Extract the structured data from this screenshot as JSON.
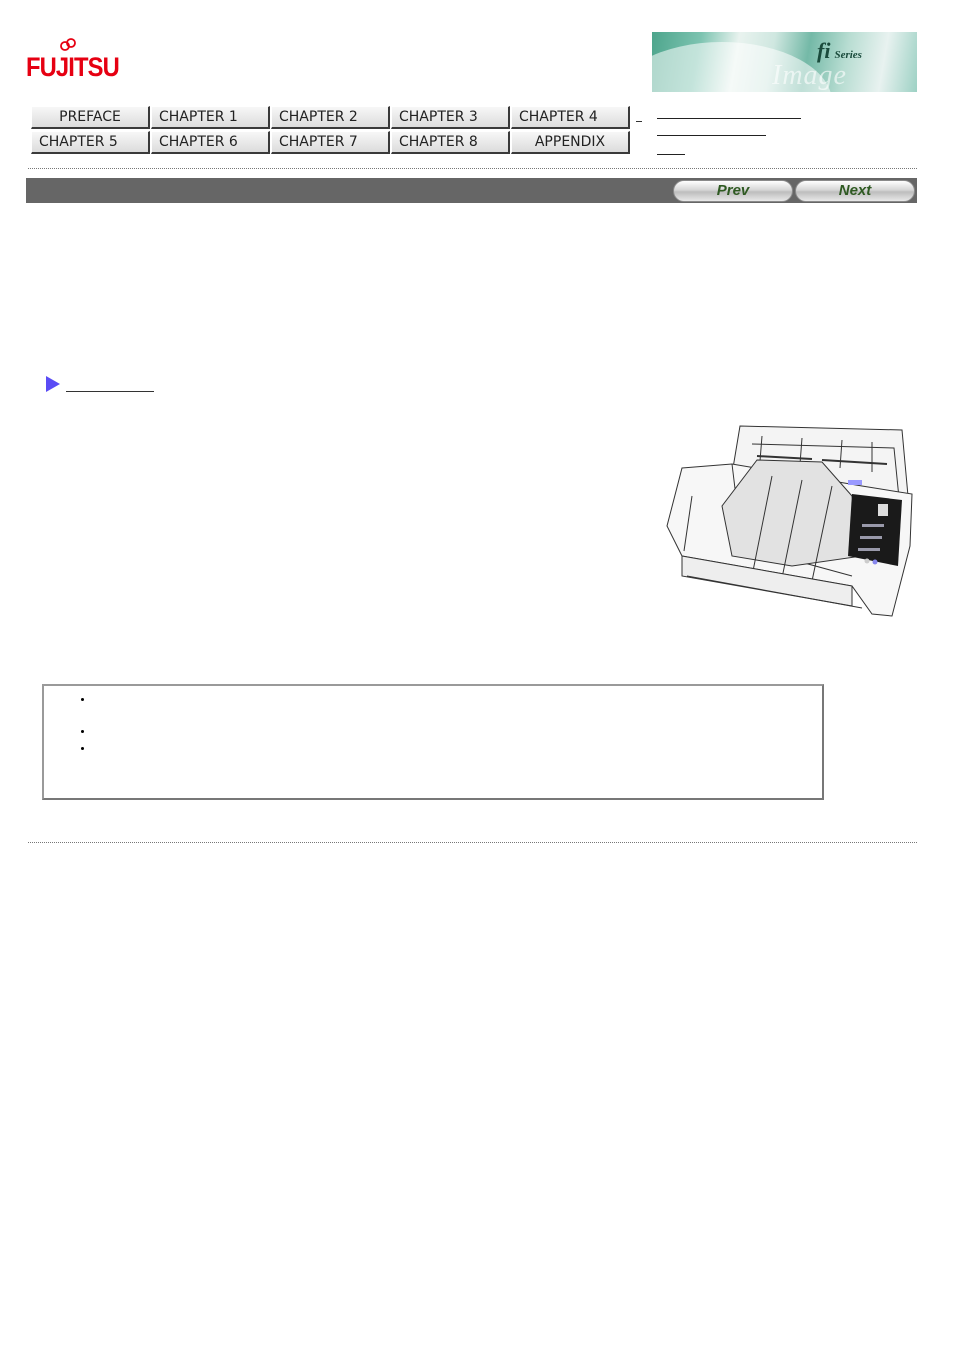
{
  "header": {
    "logo_text": "FUJITSU",
    "banner": {
      "fi": "fi",
      "series": "Series",
      "watermark": "Image Scanner"
    }
  },
  "nav": {
    "row1": [
      "PREFACE",
      "CHAPTER 1",
      "CHAPTER 2",
      "CHAPTER 3",
      "CHAPTER 4"
    ],
    "row2": [
      "CHAPTER 5",
      "CHAPTER 6",
      "CHAPTER 7",
      "CHAPTER 8",
      "APPENDIX"
    ]
  },
  "pager": {
    "prev_label": "Prev",
    "next_label": "Next"
  },
  "colors": {
    "brand_red": "#e60012",
    "titlebar": "#666666",
    "arrow": "#5a4cf5",
    "pager_text": "#2f5a22"
  },
  "notes": {
    "bullet_count": 3
  }
}
